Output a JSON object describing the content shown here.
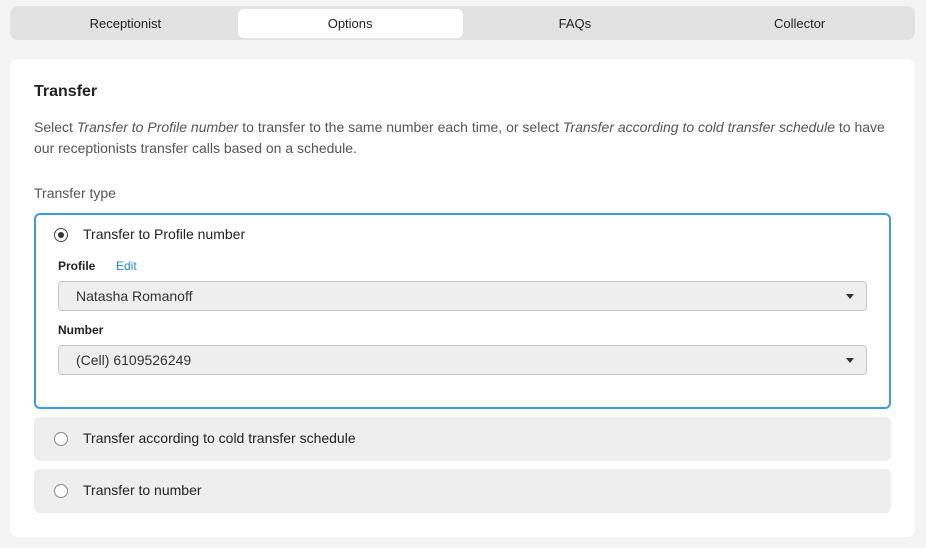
{
  "tabs": [
    {
      "label": "Receptionist",
      "active": false
    },
    {
      "label": "Options",
      "active": true
    },
    {
      "label": "FAQs",
      "active": false
    },
    {
      "label": "Collector",
      "active": false
    }
  ],
  "transfer": {
    "title": "Transfer",
    "desc_1": "Select ",
    "desc_em_1": "Transfer to Profile number",
    "desc_2": " to transfer to the same number each time, or select ",
    "desc_em_2": "Transfer according to cold transfer schedule",
    "desc_3": " to have our receptionists transfer calls based on a schedule.",
    "type_label": "Transfer type",
    "options": [
      {
        "label": "Transfer to Profile number",
        "selected": true
      },
      {
        "label": "Transfer according to cold transfer schedule",
        "selected": false
      },
      {
        "label": "Transfer to number",
        "selected": false
      }
    ],
    "profile_label": "Profile",
    "edit_label": "Edit",
    "profile_value": "Natasha Romanoff",
    "number_label": "Number",
    "number_value": "(Cell) 6109526249"
  },
  "colors": {
    "accent_border": "#3d9be0",
    "link": "#1e88c8",
    "option_bg": "#eeeeee"
  }
}
